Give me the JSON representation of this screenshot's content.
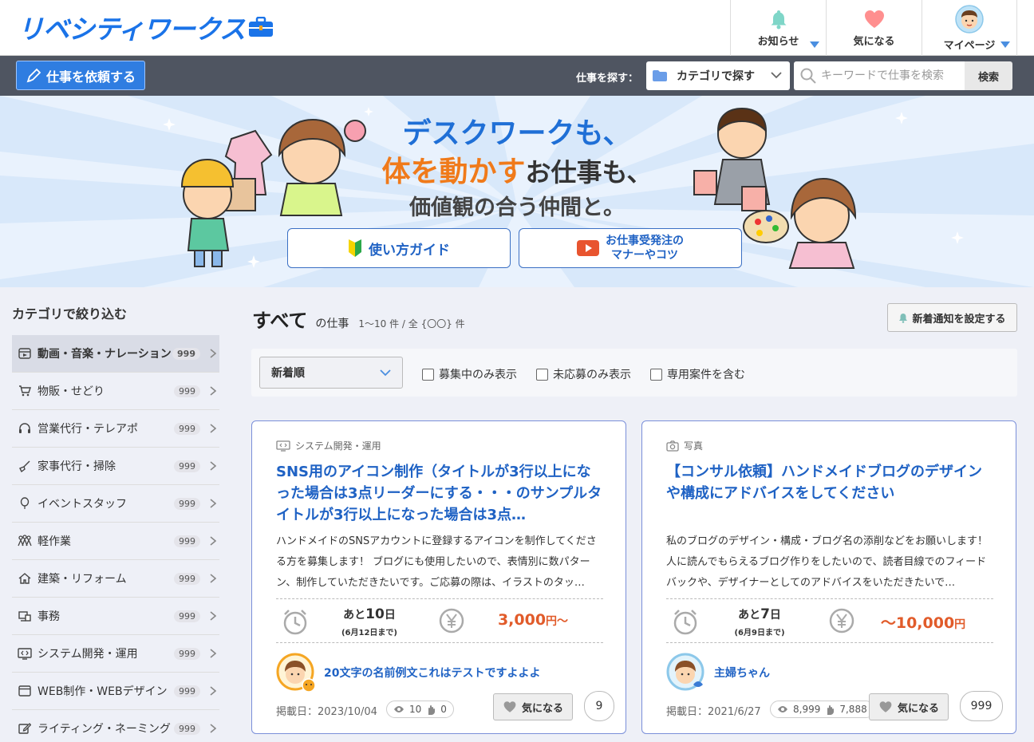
{
  "header": {
    "logo_text": "リベシティワークス",
    "nav": [
      {
        "label": "お知らせ",
        "icon": "bell-icon"
      },
      {
        "label": "気になる",
        "icon": "heart-icon"
      },
      {
        "label": "マイページ",
        "icon": "avatar"
      }
    ]
  },
  "toolbar": {
    "request_label": "仕事を依頼する",
    "search_label": "仕事を探す：",
    "category_select": "カテゴリで探す",
    "keyword_placeholder": "キーワードで仕事を検索",
    "search_button": "検索"
  },
  "hero": {
    "line1": "デスクワークも、",
    "line2_highlight": "体を動かす",
    "line2_rest": "お仕事も、",
    "line3": "価値観の合う仲間と。",
    "guide_button": "使い方ガイド",
    "manner_button_l1": "お仕事受発注の",
    "manner_button_l2": "マナーやコツ"
  },
  "sidebar": {
    "title": "カテゴリで絞り込む",
    "items": [
      {
        "label": "動画・音楽・ナレーション",
        "count": "999",
        "icon": "video-icon"
      },
      {
        "label": "物販・せどり",
        "count": "999",
        "icon": "cart-icon"
      },
      {
        "label": "営業代行・テレアポ",
        "count": "999",
        "icon": "headset-icon"
      },
      {
        "label": "家事代行・掃除",
        "count": "999",
        "icon": "broom-icon"
      },
      {
        "label": "イベントスタッフ",
        "count": "999",
        "icon": "balloon-icon"
      },
      {
        "label": "軽作業",
        "count": "999",
        "icon": "people-icon"
      },
      {
        "label": "建築・リフォーム",
        "count": "999",
        "icon": "house-icon"
      },
      {
        "label": "事務",
        "count": "999",
        "icon": "office-icon"
      },
      {
        "label": "システム開発・運用",
        "count": "999",
        "icon": "code-icon"
      },
      {
        "label": "WEB制作・WEBデザイン",
        "count": "999",
        "icon": "browser-icon"
      },
      {
        "label": "ライティング・ネーミング",
        "count": "999",
        "icon": "pen-icon"
      }
    ]
  },
  "main": {
    "title": "すべて",
    "title_suffix": "の仕事",
    "range": "1〜10 件 / 全 {〇〇} 件",
    "notify_button": "新着通知を設定する",
    "sort_value": "新着順",
    "checkboxes": [
      "募集中のみ表示",
      "未応募のみ表示",
      "専用案件を含む"
    ]
  },
  "jobs": [
    {
      "category": "システム開発・運用",
      "title": "SNS用のアイコン制作（タイトルが3行以上になった場合は3点リーダーにする・・・のサンプルタイトルが3行以上になった場合は3点…",
      "description": "ハンドメイドのSNSアカウントに登録するアイコンを制作してくださる方を募集します！ ブログにも使用したいので、表情別に数パターン、制作していただきたいです。ご応募の際は、イラストのタッ…",
      "days_prefix": "あと",
      "days": "10",
      "days_suffix": "日",
      "deadline": "(6月12日まで)",
      "price": "3,000",
      "price_unit": "円〜",
      "user": "20文字の名前例文これはテストですよよよ",
      "posted": "掲載日：2023/10/04",
      "views": "10",
      "applies": "0",
      "fav_label": "気になる",
      "fav_count": "9"
    },
    {
      "category": "写真",
      "title": "【コンサル依頼】ハンドメイドブログのデザインや構成にアドバイスをしてください",
      "description": "私のブログのデザイン・構成・ブログ名の添削などをお願いします！ 人に読んでもらえるブログ作りをしたいので、読者目線でのフィードバックや、デザイナーとしてのアドバイスをいただきたいで…",
      "days_prefix": "あと",
      "days": "7",
      "days_suffix": "日",
      "deadline": "(6月9日まで)",
      "price_prefix": "〜",
      "price": "10,000",
      "price_unit": "円",
      "user": "主婦ちゃん",
      "posted": "掲載日：2021/6/27",
      "views": "8,999",
      "applies": "7,888",
      "fav_label": "気になる",
      "fav_count": "999"
    }
  ],
  "colors": {
    "brand": "#1a73e8",
    "bar": "#4f5561",
    "price": "#e15b2a",
    "link": "#1f62c4"
  }
}
